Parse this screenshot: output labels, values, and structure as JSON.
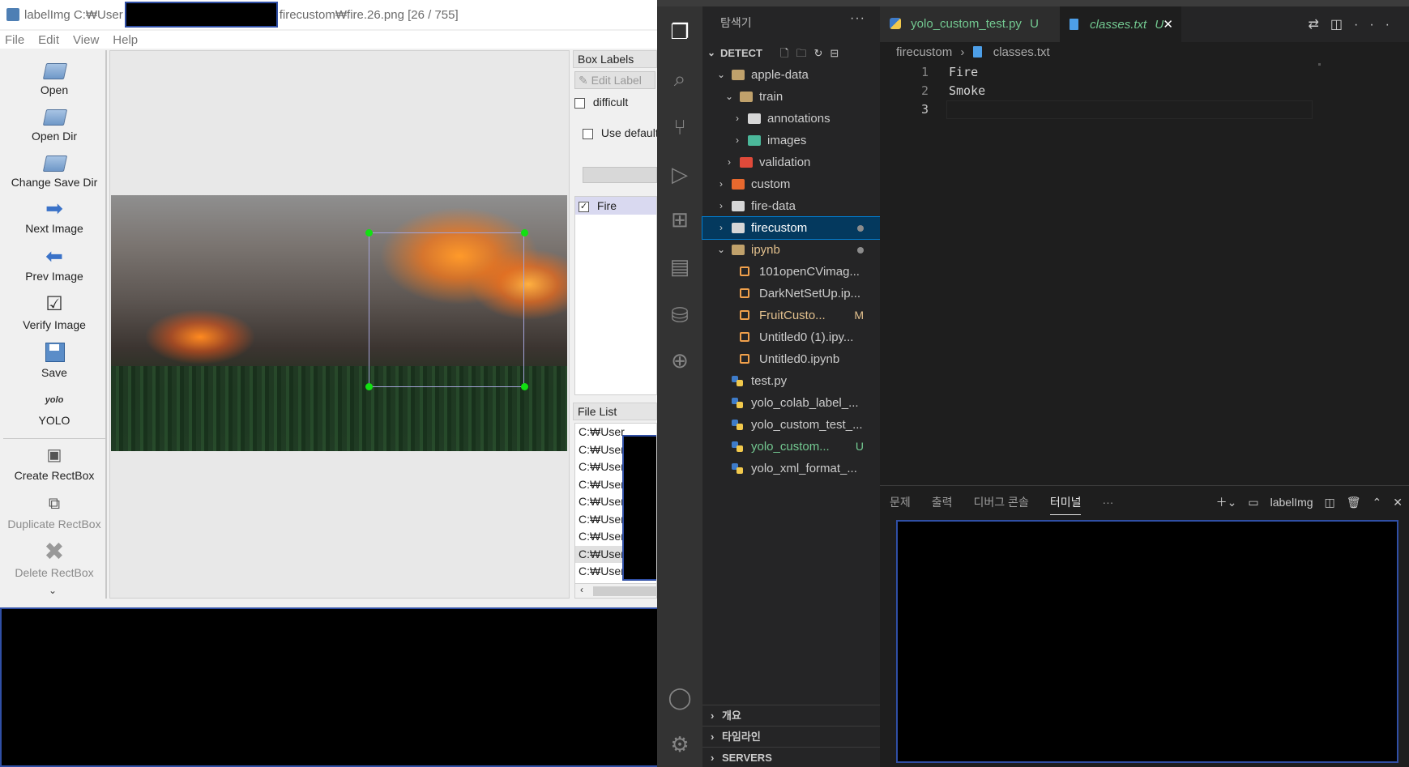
{
  "labelimg": {
    "title_prefix": "labelImg C:₩User",
    "title_suffix": "firecustom₩fire.26.png [26 / 755]",
    "menu": [
      "File",
      "Edit",
      "View",
      "Help"
    ],
    "tools": [
      {
        "label": "Open",
        "icon": "folder-icon"
      },
      {
        "label": "Open Dir",
        "icon": "folder-icon"
      },
      {
        "label": "Change Save Dir",
        "icon": "folder-icon"
      },
      {
        "label": "Next Image",
        "icon": "arrow-right-icon"
      },
      {
        "label": "Prev Image",
        "icon": "arrow-left-icon"
      },
      {
        "label": "Verify Image",
        "icon": "checkbox-icon"
      },
      {
        "label": "Save",
        "icon": "save-icon"
      },
      {
        "label": "YOLO",
        "icon": "yolo-icon",
        "icon_text": "yolo"
      },
      {
        "label": "Create RectBox",
        "icon": "create-rect-icon"
      },
      {
        "label": "Duplicate RectBox",
        "icon": "duplicate-rect-icon"
      },
      {
        "label": "Delete RectBox",
        "icon": "delete-rect-icon"
      }
    ],
    "box_labels": {
      "header": "Box Labels",
      "edit_label": "Edit Label",
      "difficult": "difficult",
      "use_default": "Use default label",
      "labels": [
        {
          "text": "Fire",
          "checked": true
        }
      ]
    },
    "file_list": {
      "header": "File List",
      "items": [
        "C:₩User",
        "C:₩User",
        "C:₩User",
        "C:₩User",
        "C:₩User",
        "C:₩User",
        "C:₩User",
        "C:₩User",
        "C:₩User"
      ],
      "selected_index": 7
    },
    "annotation_color": "#12e012"
  },
  "vscode": {
    "explorer_title": "탐색기",
    "root": "DETECT",
    "tree": [
      {
        "label": "apple-data",
        "depth": 1,
        "kind": "folder",
        "open": true,
        "icon": "folder-open-icon"
      },
      {
        "label": "train",
        "depth": 2,
        "kind": "folder",
        "open": true,
        "icon": "folder-open-icon"
      },
      {
        "label": "annotations",
        "depth": 3,
        "kind": "folder",
        "open": false,
        "icon": "folder-icon"
      },
      {
        "label": "images",
        "depth": 3,
        "kind": "folder",
        "open": false,
        "icon": "images-folder-icon"
      },
      {
        "label": "validation",
        "depth": 2,
        "kind": "folder",
        "open": false,
        "icon": "red-folder-icon"
      },
      {
        "label": "custom",
        "depth": 1,
        "kind": "folder",
        "open": false,
        "icon": "orange-folder-icon"
      },
      {
        "label": "fire-data",
        "depth": 1,
        "kind": "folder",
        "open": false,
        "icon": "folder-icon"
      },
      {
        "label": "firecustom",
        "depth": 1,
        "kind": "folder",
        "open": false,
        "icon": "folder-icon",
        "selected": true,
        "dot": true
      },
      {
        "label": "ipynb",
        "depth": 1,
        "kind": "folder",
        "open": true,
        "icon": "folder-open-icon",
        "dot": true
      },
      {
        "label": "101openCVimag...",
        "depth": 2,
        "kind": "notebook",
        "icon": "notebook-icon"
      },
      {
        "label": "DarkNetSetUp.ip...",
        "depth": 2,
        "kind": "notebook",
        "icon": "notebook-icon"
      },
      {
        "label": "FruitCusto...",
        "depth": 2,
        "kind": "notebook",
        "icon": "notebook-icon",
        "badge": "M"
      },
      {
        "label": "Untitled0 (1).ipy...",
        "depth": 2,
        "kind": "notebook",
        "icon": "notebook-icon"
      },
      {
        "label": "Untitled0.ipynb",
        "depth": 2,
        "kind": "notebook",
        "icon": "notebook-icon"
      },
      {
        "label": "test.py",
        "depth": 1,
        "kind": "python",
        "icon": "python-icon"
      },
      {
        "label": "yolo_colab_label_...",
        "depth": 1,
        "kind": "python",
        "icon": "python-icon"
      },
      {
        "label": "yolo_custom_test_...",
        "depth": 1,
        "kind": "python",
        "icon": "python-icon"
      },
      {
        "label": "yolo_custom...",
        "depth": 1,
        "kind": "python",
        "icon": "python-icon",
        "badge": "U"
      },
      {
        "label": "yolo_xml_format_...",
        "depth": 1,
        "kind": "python",
        "icon": "python-icon"
      }
    ],
    "sidebar_sections": [
      "개요",
      "타임라인",
      "SERVERS"
    ],
    "tabs": [
      {
        "label": "yolo_custom_test.py",
        "badge": "U"
      },
      {
        "label": "classes.txt",
        "badge": "U",
        "active": true
      }
    ],
    "breadcrumb": [
      "firecustom",
      "classes.txt"
    ],
    "code_lines": [
      {
        "num": "1",
        "text": "Fire"
      },
      {
        "num": "2",
        "text": "Smoke"
      },
      {
        "num": "3",
        "text": ""
      }
    ],
    "panel_tabs": [
      "문제",
      "출력",
      "디버그 콘솔",
      "터미널"
    ],
    "active_panel_tab": "터미널",
    "terminal_name": "labelImg",
    "modified_color": "#e2c08d",
    "untracked_color": "#73c991"
  }
}
